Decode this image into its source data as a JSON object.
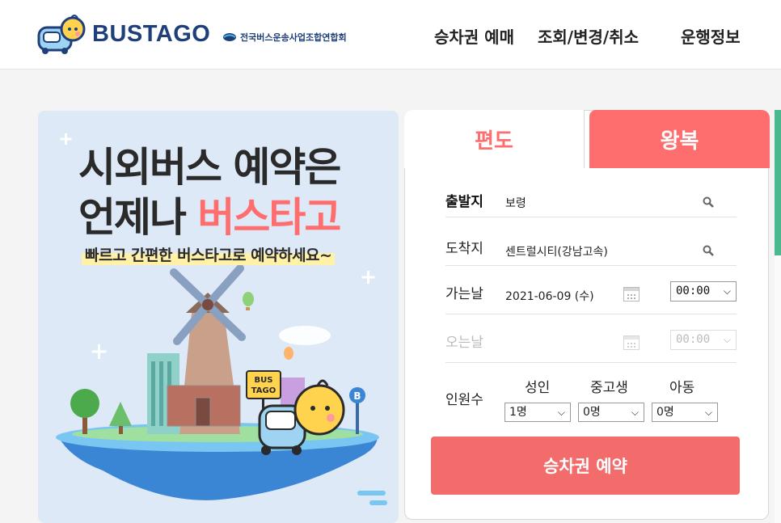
{
  "header": {
    "brand": "BUSTAGO",
    "association": "전국버스운송사업조합연합회",
    "nav": [
      {
        "label": "승차권 예매"
      },
      {
        "label": "조회/변경/취소"
      },
      {
        "label": "운행정보"
      }
    ]
  },
  "banner": {
    "title_line1": "시외버스 예약은",
    "title_line2_prefix": "언제나 ",
    "title_line2_accent": "버스타고",
    "subtitle": "빠르고 간편한 버스타고로 예약하세요~",
    "sign_text_1": "BUS",
    "sign_text_2": "TAGO",
    "stop_letter": "B"
  },
  "booking": {
    "tabs": {
      "oneway": "편도",
      "roundtrip": "왕복",
      "active": "oneway"
    },
    "departure": {
      "label": "출발지",
      "value": "보령"
    },
    "arrival": {
      "label": "도착지",
      "value": "센트럴시티(강남고속)"
    },
    "go_date": {
      "label": "가는날",
      "value": "2021-06-09 (수)",
      "time": "00:00"
    },
    "return_date": {
      "label": "오는날",
      "value": "",
      "time": "00:00"
    },
    "passengers": {
      "label": "인원수",
      "adult": {
        "label": "성인",
        "value": "1명"
      },
      "youth": {
        "label": "중고생",
        "value": "0명"
      },
      "child": {
        "label": "아동",
        "value": "0명"
      }
    },
    "submit_label": "승차권 예약"
  },
  "colors": {
    "brand_navy": "#1e3f7a",
    "accent_red": "#ff6e6e",
    "button_red": "#f26c6c",
    "side_green": "#4bb98d"
  },
  "icons": {
    "search": "search-icon",
    "calendar": "calendar-icon",
    "dropdown": "chevron-down-icon"
  }
}
